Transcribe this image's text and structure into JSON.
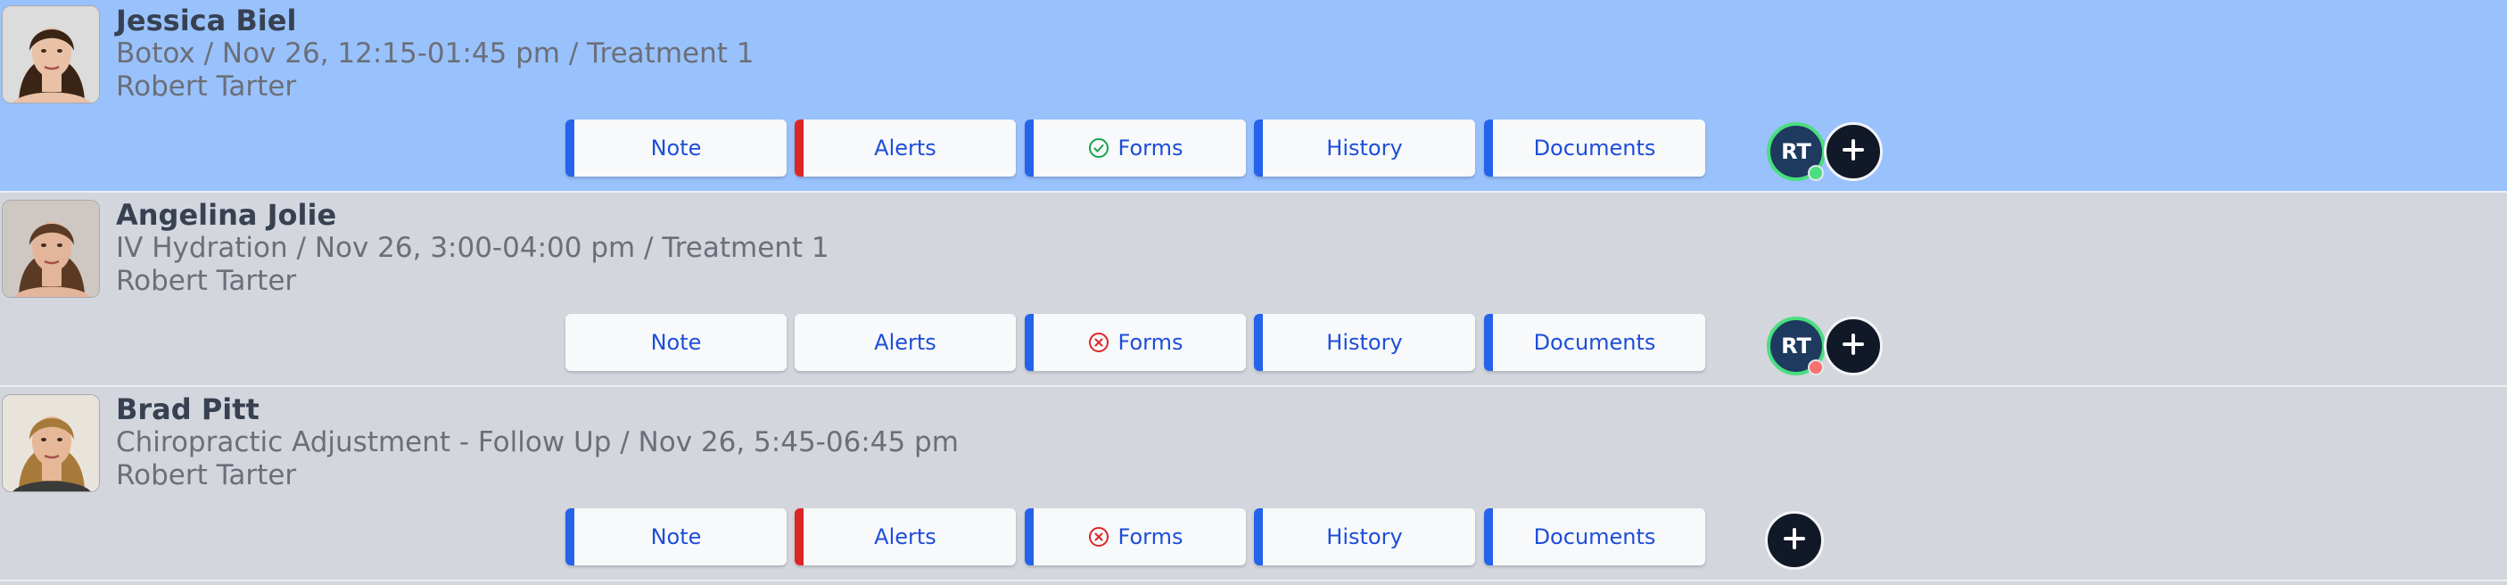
{
  "colors": {
    "selected_row": "#99c2fd",
    "row": "#d4d6de",
    "accent_blue": "#2563eb",
    "alert_red": "#dc2626",
    "ok_green": "#16a34a",
    "error_red": "#dc2626",
    "online_dot": "#4ade80",
    "away_dot": "#f87171"
  },
  "appointments": [
    {
      "patient_name": "Jessica Biel",
      "detail": "Botox / Nov 26, 12:15-01:45 pm / Treatment 1",
      "provider": "Robert Tarter",
      "selected": true,
      "buttons": {
        "note": {
          "label": "Note",
          "bar": "blue"
        },
        "alerts": {
          "label": "Alerts",
          "bar": "red"
        },
        "forms": {
          "label": "Forms",
          "bar": "blue",
          "status_icon": "check-circle-icon"
        },
        "history": {
          "label": "History",
          "bar": "blue"
        },
        "documents": {
          "label": "Documents",
          "bar": "blue"
        }
      },
      "assignee": {
        "initials": "RT",
        "presence": "online"
      }
    },
    {
      "patient_name": "Angelina Jolie",
      "detail": "IV Hydration / Nov 26, 3:00-04:00 pm / Treatment 1",
      "provider": "Robert Tarter",
      "selected": false,
      "buttons": {
        "note": {
          "label": "Note",
          "bar": "none"
        },
        "alerts": {
          "label": "Alerts",
          "bar": "none"
        },
        "forms": {
          "label": "Forms",
          "bar": "blue",
          "status_icon": "x-circle-icon"
        },
        "history": {
          "label": "History",
          "bar": "blue"
        },
        "documents": {
          "label": "Documents",
          "bar": "blue"
        }
      },
      "assignee": {
        "initials": "RT",
        "presence": "away"
      }
    },
    {
      "patient_name": "Brad Pitt",
      "detail": "Chiropractic Adjustment - Follow Up / Nov 26, 5:45-06:45 pm",
      "provider": "Robert Tarter",
      "selected": false,
      "buttons": {
        "note": {
          "label": "Note",
          "bar": "blue"
        },
        "alerts": {
          "label": "Alerts",
          "bar": "red"
        },
        "forms": {
          "label": "Forms",
          "bar": "blue",
          "status_icon": "x-circle-icon"
        },
        "history": {
          "label": "History",
          "bar": "blue"
        },
        "documents": {
          "label": "Documents",
          "bar": "blue"
        }
      },
      "assignee": null
    }
  ]
}
